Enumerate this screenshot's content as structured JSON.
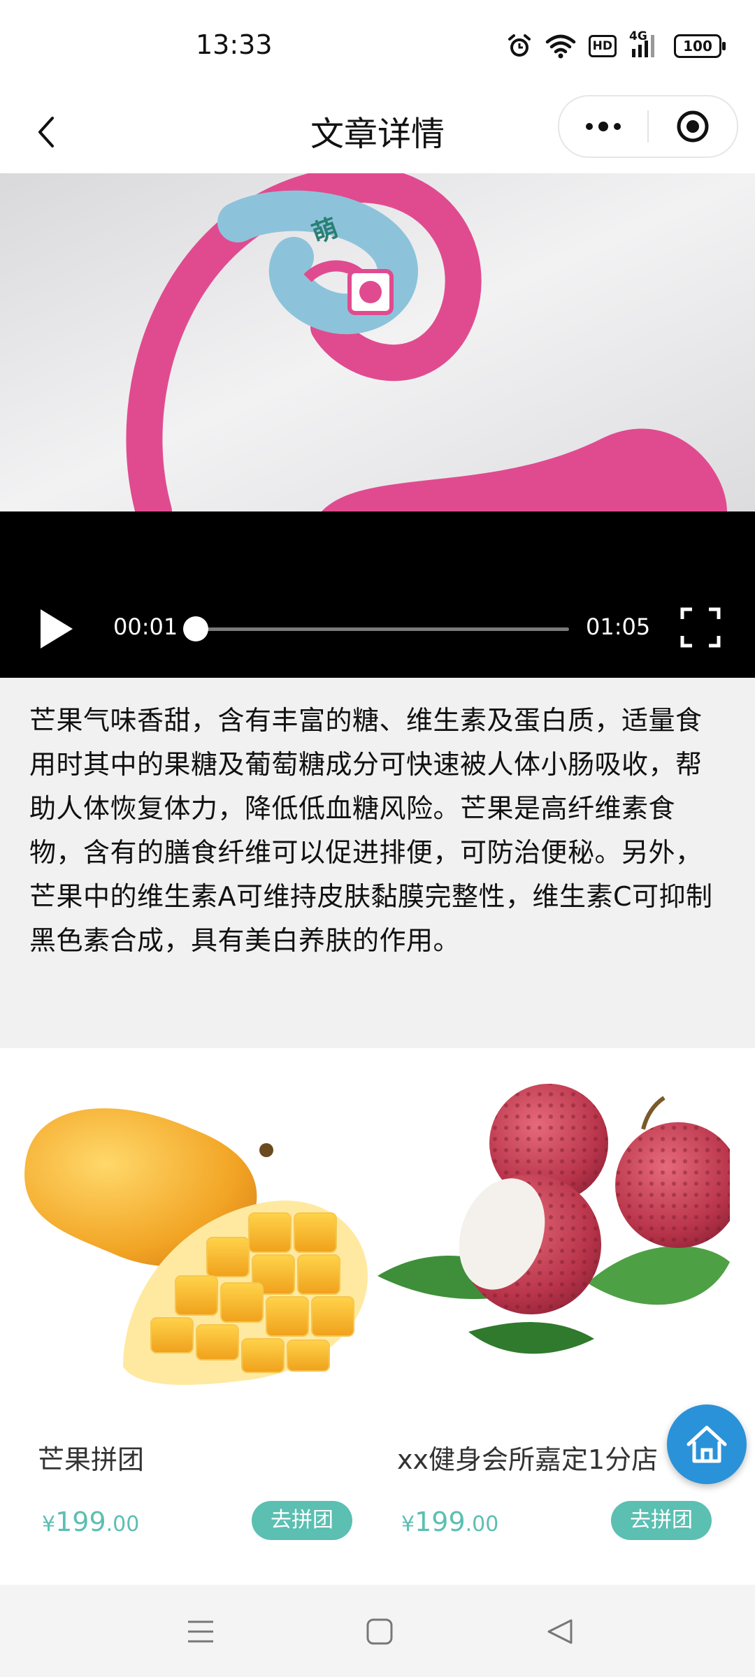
{
  "status_bar": {
    "time": "13:33",
    "icons": [
      "alarm-icon",
      "wifi-icon",
      "hd-icon",
      "signal-4g-icon",
      "battery-icon"
    ],
    "hd_label": "HD",
    "network_label": "4G",
    "battery": "100"
  },
  "nav": {
    "title": "文章详情",
    "icons": [
      "back-arrow-icon",
      "more-dots-icon",
      "target-icon"
    ]
  },
  "video": {
    "current_time": "00:01",
    "duration": "01:05",
    "progress": 0.015,
    "frame_label": "萌",
    "icons": [
      "play-icon",
      "fullscreen-icon"
    ]
  },
  "article": {
    "text": "芒果气味香甜，含有丰富的糖、维生素及蛋白质，适量食用时其中的果糖及葡萄糖成分可快速被人体小肠吸收，帮助人体恢复体力，降低低血糖风险。芒果是高纤维素食物，含有的膳食纤维可以促进排便，可防治便秘。另外，芒果中的维生素A可维持皮肤黏膜完整性，维生素C可抑制黑色素合成，具有美白养肤的作用。"
  },
  "products": [
    {
      "name": "芒果拼团",
      "currency": "¥",
      "price_int": "199",
      "price_dec": ".00",
      "button": "去拼团"
    },
    {
      "name": "xx健身会所嘉定1分店",
      "currency": "¥",
      "price_int": "199",
      "price_dec": ".00",
      "button": "去拼团"
    }
  ],
  "floating": {
    "icon": "home-icon"
  },
  "system_nav": {
    "icons": [
      "menu-icon",
      "home-square-icon",
      "back-triangle-icon"
    ]
  },
  "colors": {
    "accent": "#5bbfb2",
    "fab": "#2a92d8",
    "video_bg": "#000000",
    "article_bg": "#f1f1f1",
    "brand_pink": "#e04b8f"
  }
}
